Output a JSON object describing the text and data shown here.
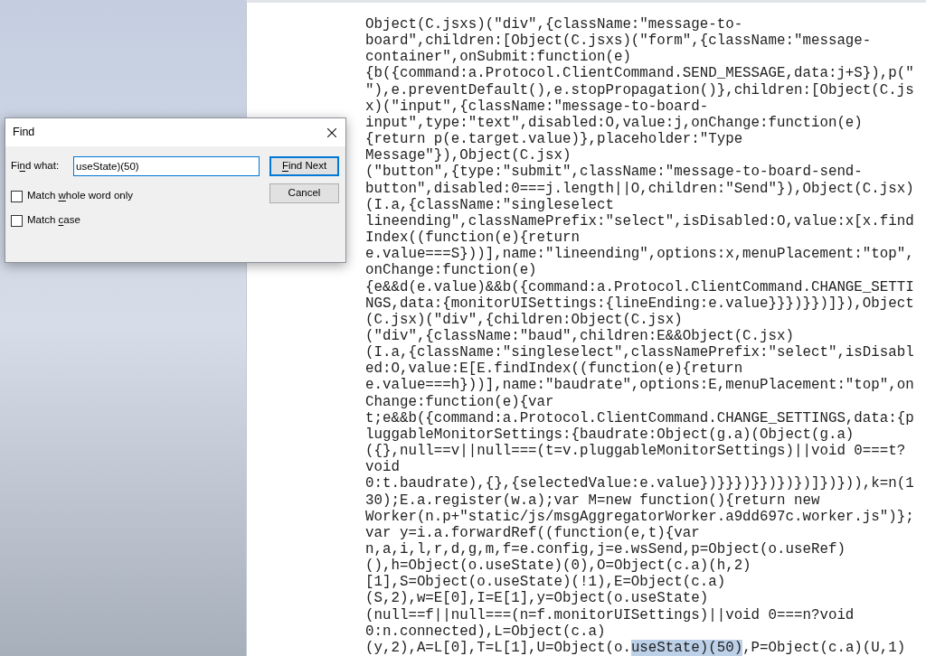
{
  "document": {
    "lines": [
      [
        {
          "text": "Object(C.jsxs)(\"div\",{className:\"message-to-",
          "highlighted": false
        }
      ],
      [
        {
          "text": "board\",children:[Object(C.jsxs)(\"form\",{className:\"message-",
          "highlighted": false
        }
      ],
      [
        {
          "text": "container\",onSubmit:function(e)",
          "highlighted": false
        }
      ],
      [
        {
          "text": "{b({command:a.Protocol.ClientCommand.SEND_MESSAGE,data:j+S}),p(\"",
          "highlighted": false
        }
      ],
      [
        {
          "text": "\"),e.preventDefault(),e.stopPropagation()},children:[Object(C.js",
          "highlighted": false
        }
      ],
      [
        {
          "text": "x)(\"input\",{className:\"message-to-board-",
          "highlighted": false
        }
      ],
      [
        {
          "text": "input\",type:\"text\",disabled:O,value:j,onChange:function(e)",
          "highlighted": false
        }
      ],
      [
        {
          "text": "{return p(e.target.value)},placeholder:\"Type",
          "highlighted": false
        }
      ],
      [
        {
          "text": "Message\"}),Object(C.jsx)",
          "highlighted": false
        }
      ],
      [
        {
          "text": "(\"button\",{type:\"submit\",className:\"message-to-board-send-",
          "highlighted": false
        }
      ],
      [
        {
          "text": "button\",disabled:0===j.length||O,children:\"Send\"}),Object(C.jsx)",
          "highlighted": false
        }
      ],
      [
        {
          "text": "(I.a,{className:\"singleselect",
          "highlighted": false
        }
      ],
      [
        {
          "text": "lineending\",classNamePrefix:\"select\",isDisabled:O,value:x[x.find",
          "highlighted": false
        }
      ],
      [
        {
          "text": "Index((function(e){return",
          "highlighted": false
        }
      ],
      [
        {
          "text": "e.value===S}))],name:\"lineending\",options:x,menuPlacement:\"top\",",
          "highlighted": false
        }
      ],
      [
        {
          "text": "onChange:function(e)",
          "highlighted": false
        }
      ],
      [
        {
          "text": "{e&&d(e.value)&&b({command:a.Protocol.ClientCommand.CHANGE_SETTI",
          "highlighted": false
        }
      ],
      [
        {
          "text": "NGS,data:{monitorUISettings:{lineEnding:e.value}}})}})]}),Object",
          "highlighted": false
        }
      ],
      [
        {
          "text": "(C.jsx)(\"div\",{children:Object(C.jsx)",
          "highlighted": false
        }
      ],
      [
        {
          "text": "(\"div\",{className:\"baud\",children:E&&Object(C.jsx)",
          "highlighted": false
        }
      ],
      [
        {
          "text": "(I.a,{className:\"singleselect\",classNamePrefix:\"select\",isDisabl",
          "highlighted": false
        }
      ],
      [
        {
          "text": "ed:O,value:E[E.findIndex((function(e){return",
          "highlighted": false
        }
      ],
      [
        {
          "text": "e.value===h}))],name:\"baudrate\",options:E,menuPlacement:\"top\",on",
          "highlighted": false
        }
      ],
      [
        {
          "text": "Change:function(e){var",
          "highlighted": false
        }
      ],
      [
        {
          "text": "t;e&&b({command:a.Protocol.ClientCommand.CHANGE_SETTINGS,data:{p",
          "highlighted": false
        }
      ],
      [
        {
          "text": "luggableMonitorSettings:{baudrate:Object(g.a)(Object(g.a)",
          "highlighted": false
        }
      ],
      [
        {
          "text": "({},null==v||null===(t=v.pluggableMonitorSettings)||void 0===t?",
          "highlighted": false
        }
      ],
      [
        {
          "text": "void",
          "highlighted": false
        }
      ],
      [
        {
          "text": "0:t.baudrate),{},{selectedValue:e.value})}}})}})})})]})})),k=n(1",
          "highlighted": false
        }
      ],
      [
        {
          "text": "30);E.a.register(w.a);var M=new function(){return new",
          "highlighted": false
        }
      ],
      [
        {
          "text": "Worker(n.p+\"static/js/msgAggregatorWorker.a9dd697c.worker.js\")};",
          "highlighted": false
        }
      ],
      [
        {
          "text": "var y=i.a.forwardRef((function(e,t){var",
          "highlighted": false
        }
      ],
      [
        {
          "text": "n,a,i,l,r,d,g,m,f=e.config,j=e.wsSend,p=Object(o.useRef)",
          "highlighted": false
        }
      ],
      [
        {
          "text": "(),h=Object(o.useState)(0),O=Object(c.a)(h,2)",
          "highlighted": false
        }
      ],
      [
        {
          "text": "[1],S=Object(o.useState)(!1),E=Object(c.a)",
          "highlighted": false
        }
      ],
      [
        {
          "text": "(S,2),w=E[0],I=E[1],y=Object(o.useState)",
          "highlighted": false
        }
      ],
      [
        {
          "text": "(null==f||null===(n=f.monitorUISettings)||void 0===n?void",
          "highlighted": false
        }
      ],
      [
        {
          "text": "0:n.connected),L=Object(c.a)",
          "highlighted": false
        }
      ],
      [
        {
          "text": "(y,2),A=L[0],T=L[1],U=Object(o.",
          "highlighted": false
        },
        {
          "text": "useState)(50)",
          "highlighted": true
        },
        {
          "text": ",P=Object(c.a)(U,1)",
          "highlighted": false
        }
      ]
    ]
  },
  "find_dialog": {
    "title": "Find",
    "find_what": {
      "label": [
        {
          "text": "Fi",
          "access_key": false
        },
        {
          "text": "n",
          "access_key": true
        },
        {
          "text": "d what:",
          "access_key": false
        }
      ],
      "value": "useState)(50)",
      "focused": true
    },
    "options": [
      {
        "label": [
          {
            "text": "Match ",
            "access_key": false
          },
          {
            "text": "w",
            "access_key": true
          },
          {
            "text": "hole word only",
            "access_key": false
          }
        ],
        "checked": false
      },
      {
        "label": [
          {
            "text": "Match ",
            "access_key": false
          },
          {
            "text": "c",
            "access_key": true
          },
          {
            "text": "ase",
            "access_key": false
          }
        ],
        "checked": false
      }
    ],
    "buttons": [
      {
        "label": [
          {
            "text": "F",
            "access_key": true
          },
          {
            "text": "ind Next",
            "access_key": false
          }
        ],
        "default": true
      },
      {
        "label": [
          {
            "text": "Cancel",
            "access_key": false
          }
        ],
        "default": false
      }
    ]
  }
}
